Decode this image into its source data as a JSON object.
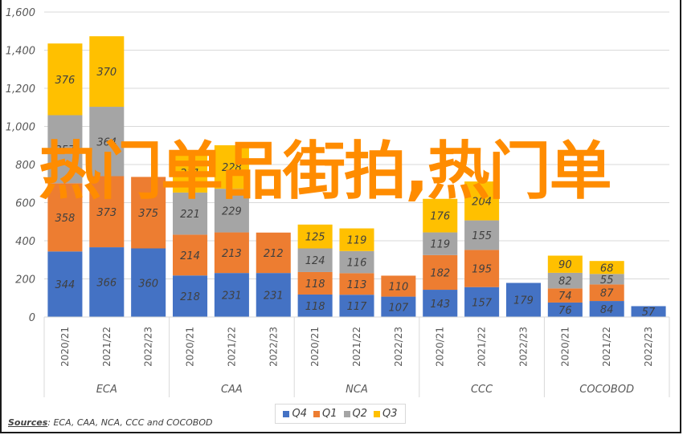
{
  "chart_data": {
    "type": "bar",
    "stacked": true,
    "title": "",
    "xlabel": "",
    "ylabel": "",
    "ylim": [
      0,
      1600
    ],
    "yticks": [
      0,
      200,
      400,
      600,
      800,
      1000,
      1200,
      1400,
      1600
    ],
    "ytick_labels": [
      "0",
      "200",
      "400",
      "600",
      "800",
      "1,000",
      "1,200",
      "1,400",
      "1,600"
    ],
    "grid": true,
    "groups": [
      {
        "name": "ECA",
        "categories": [
          "2020/21",
          "2021/22",
          "2022/23"
        ]
      },
      {
        "name": "CAA",
        "categories": [
          "2020/21",
          "2021/22",
          "2022/23"
        ]
      },
      {
        "name": "NCA",
        "categories": [
          "2020/21",
          "2021/22",
          "2022/23"
        ]
      },
      {
        "name": "CCC",
        "categories": [
          "2020/21",
          "2021/22",
          "2022/23"
        ]
      },
      {
        "name": "COCOBOD",
        "categories": [
          "2020/21",
          "2021/22",
          "2022/23"
        ]
      }
    ],
    "series": [
      {
        "name": "Q4",
        "color": "#4472c4",
        "values": [
          344,
          366,
          360,
          218,
          231,
          231,
          118,
          117,
          107,
          143,
          157,
          179,
          76,
          84,
          57
        ]
      },
      {
        "name": "Q1",
        "color": "#ed7d31",
        "values": [
          358,
          373,
          375,
          214,
          213,
          212,
          118,
          113,
          110,
          182,
          195,
          null,
          74,
          87,
          null
        ]
      },
      {
        "name": "Q2",
        "color": "#a5a5a5",
        "values": [
          357,
          364,
          null,
          221,
          229,
          null,
          124,
          116,
          null,
          119,
          155,
          null,
          82,
          55,
          null
        ]
      },
      {
        "name": "Q3",
        "color": "#ffc000",
        "values": [
          376,
          370,
          null,
          211,
          228,
          null,
          125,
          119,
          null,
          176,
          204,
          null,
          90,
          68,
          null
        ]
      }
    ],
    "legend": {
      "position": "bottom",
      "entries": [
        "Q4",
        "Q1",
        "Q2",
        "Q3"
      ]
    }
  },
  "source": {
    "label": "Sources",
    "text": ": ECA, CAA, NCA, CCC and COCOBOD"
  },
  "watermark": {
    "text": "热门单品街拍,热门单"
  }
}
